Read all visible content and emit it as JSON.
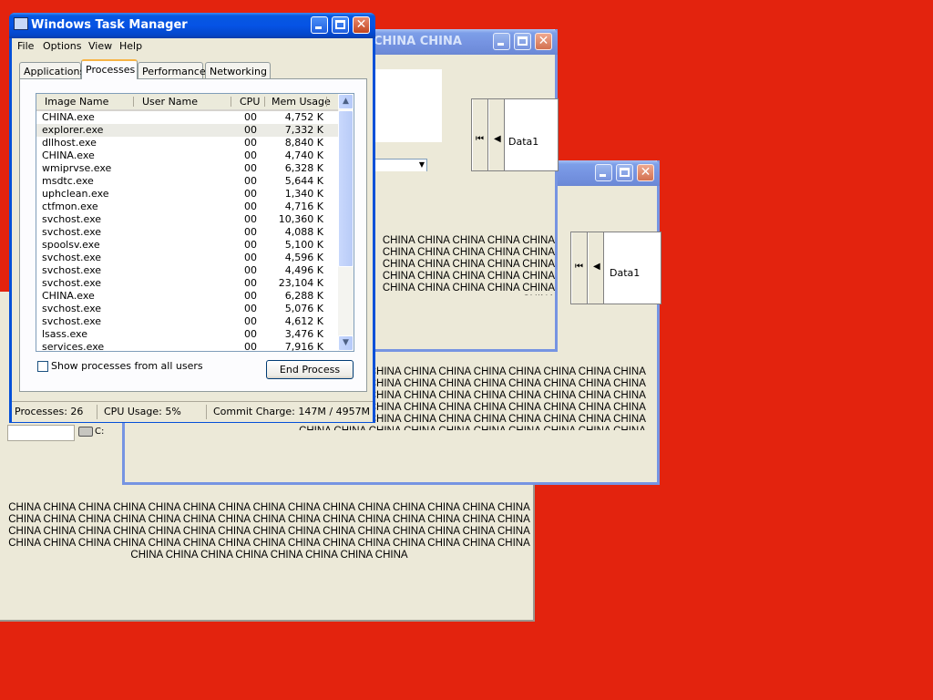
{
  "colors": {
    "desktop": "#e3230e",
    "titlebar_active": "#0553e5",
    "titlebar_inactive": "#7694e2",
    "panel": "#ece9d8"
  },
  "china_blocks": {
    "bottom_panel": "CHINA CHINA CHINA CHINA CHINA CHINA CHINA CHINA CHINA CHINA CHINA CHINA CHINA CHINA CHINA CHINA CHINA CHINA CHINA CHINA CHINA CHINA CHINA CHINA CHINA CHINA CHINA CHINA CHINA CHINA CHINA CHINA CHINA CHINA CHINA CHINA CHINA CHINA CHINA CHINA CHINA CHINA CHINA CHINA CHINA CHINA CHINA CHINA CHINA CHINA CHINA CHINA CHINA CHINA CHINA CHINA CHINA CHINA CHINA CHINA CHINA CHINA CHINA CHINA CHINA CHINA CHINA CHINA",
    "mid_window": "CHINA CHINA CHINA CHINA CHINA CHINA CHINA CHINA CHINA CHINA CHINA CHINA CHINA CHINA CHINA CHINA CHINA CHINA CHINA CHINA CHINA CHINA CHINA CHINA CHINA CHINA CHINA CHINA CHINA CHINA CHINA CHINA CHINA CHINA CHINA CHINA CHINA CHINA CHINA CHINA CHINA CHINA CHINA CHINA CHINA CHINA CHINA CHINA CHINA CHINA CHINA CHINA CHINA CHINA CHINA CHINA CHINA CHINA CHINA CHINA CHINA CHINA CHINA CHINA CHINA CHINA",
    "top_window": "CHINA CHINA CHINA CHINA CHINA CHINA CHINA CHINA CHINA CHINA CHINA CHINA CHINA CHINA CHINA CHINA CHINA CHINA CHINA CHINA CHINA CHINA CHINA CHINA CHINA CHINA"
  },
  "back_windows": {
    "top": {
      "title": "CHINA CHINA",
      "data_label": "Data1"
    },
    "mid": {
      "data_label": "Data1"
    },
    "drive_label": "C:"
  },
  "taskmgr": {
    "title": "Windows Task Manager",
    "menu": [
      "File",
      "Options",
      "View",
      "Help"
    ],
    "tabs": [
      "Applications",
      "Processes",
      "Performance",
      "Networking"
    ],
    "columns": [
      "Image Name",
      "User Name",
      "CPU",
      "Mem Usage"
    ],
    "rows": [
      {
        "name": "CHINA.exe",
        "user": "",
        "cpu": "00",
        "mem": "4,752 K"
      },
      {
        "name": "explorer.exe",
        "user": "",
        "cpu": "00",
        "mem": "7,332 K"
      },
      {
        "name": "dllhost.exe",
        "user": "",
        "cpu": "00",
        "mem": "8,840 K"
      },
      {
        "name": "CHINA.exe",
        "user": "",
        "cpu": "00",
        "mem": "4,740 K"
      },
      {
        "name": "wmiprvse.exe",
        "user": "",
        "cpu": "00",
        "mem": "6,328 K"
      },
      {
        "name": "msdtc.exe",
        "user": "",
        "cpu": "00",
        "mem": "5,644 K"
      },
      {
        "name": "uphclean.exe",
        "user": "",
        "cpu": "00",
        "mem": "1,340 K"
      },
      {
        "name": "ctfmon.exe",
        "user": "",
        "cpu": "00",
        "mem": "4,716 K"
      },
      {
        "name": "svchost.exe",
        "user": "",
        "cpu": "00",
        "mem": "10,360 K"
      },
      {
        "name": "svchost.exe",
        "user": "",
        "cpu": "00",
        "mem": "4,088 K"
      },
      {
        "name": "spoolsv.exe",
        "user": "",
        "cpu": "00",
        "mem": "5,100 K"
      },
      {
        "name": "svchost.exe",
        "user": "",
        "cpu": "00",
        "mem": "4,596 K"
      },
      {
        "name": "svchost.exe",
        "user": "",
        "cpu": "00",
        "mem": "4,496 K"
      },
      {
        "name": "svchost.exe",
        "user": "",
        "cpu": "00",
        "mem": "23,104 K"
      },
      {
        "name": "CHINA.exe",
        "user": "",
        "cpu": "00",
        "mem": "6,288 K"
      },
      {
        "name": "svchost.exe",
        "user": "",
        "cpu": "00",
        "mem": "5,076 K"
      },
      {
        "name": "svchost.exe",
        "user": "",
        "cpu": "00",
        "mem": "4,612 K"
      },
      {
        "name": "lsass.exe",
        "user": "",
        "cpu": "00",
        "mem": "3,476 K"
      },
      {
        "name": "services.exe",
        "user": "",
        "cpu": "00",
        "mem": "7,916 K"
      }
    ],
    "show_all_label": "Show processes from all users",
    "end_process_label": "End Process",
    "status": {
      "processes": "Processes: 26",
      "cpu": "CPU Usage: 5%",
      "commit": "Commit Charge: 147M / 4957M"
    }
  }
}
